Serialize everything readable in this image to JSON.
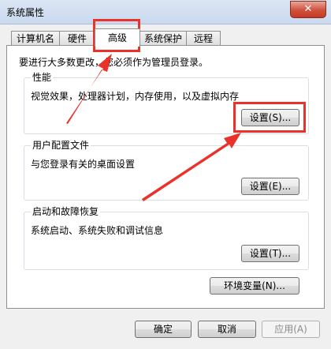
{
  "window": {
    "title": "系统属性",
    "close_label": "✕"
  },
  "tabs": [
    {
      "label": "计算机名",
      "active": false
    },
    {
      "label": "硬件",
      "active": false
    },
    {
      "label": "高级",
      "active": true
    },
    {
      "label": "系统保护",
      "active": false
    },
    {
      "label": "远程",
      "active": false
    }
  ],
  "admin_note": "要进行大多数更改，您必须作为管理员登录。",
  "groups": {
    "performance": {
      "title": "性能",
      "desc": "视觉效果，处理器计划，内存使用，以及虚拟内存",
      "button": "设置(S)..."
    },
    "user_profiles": {
      "title": "用户配置文件",
      "desc": "与您登录有关的桌面设置",
      "button": "设置(E)..."
    },
    "startup_recovery": {
      "title": "启动和故障恢复",
      "desc": "系统启动、系统失败和调试信息",
      "button": "设置(T)..."
    }
  },
  "env_button": "环境变量(N)...",
  "footer": {
    "ok": "确定",
    "cancel": "取消",
    "apply": "应用(A)"
  },
  "annotation_color": "#e8322a"
}
